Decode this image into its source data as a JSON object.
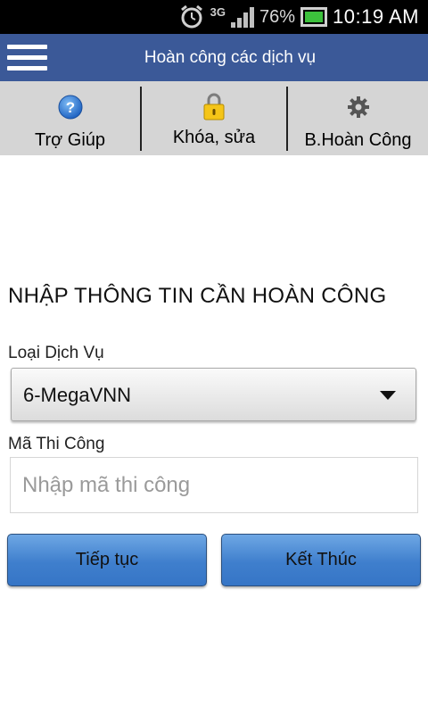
{
  "status_bar": {
    "network": "3G",
    "battery_percent": "76%",
    "time": "10:19 AM",
    "icons": [
      "alarm-icon",
      "signal-icon",
      "battery-icon"
    ]
  },
  "action_bar": {
    "title": "Hoàn công các dịch vụ",
    "color": "#3b5998"
  },
  "toolbar": {
    "items": [
      {
        "label": "Trợ Giúp",
        "icon": "help-icon"
      },
      {
        "label": "Khóa, sửa",
        "icon": "lock-icon"
      },
      {
        "label": "B.Hoàn Công",
        "icon": "gear-icon"
      }
    ]
  },
  "form": {
    "heading": "NHẬP THÔNG TIN CẦN HOÀN CÔNG",
    "service_type_label": "Loại Dịch Vụ",
    "service_type_value": "6-MegaVNN",
    "code_label": "Mã Thi Công",
    "code_placeholder": "Nhập mã thi công",
    "code_value": ""
  },
  "buttons": {
    "continue_label": "Tiếp tục",
    "finish_label": "Kết Thúc"
  }
}
